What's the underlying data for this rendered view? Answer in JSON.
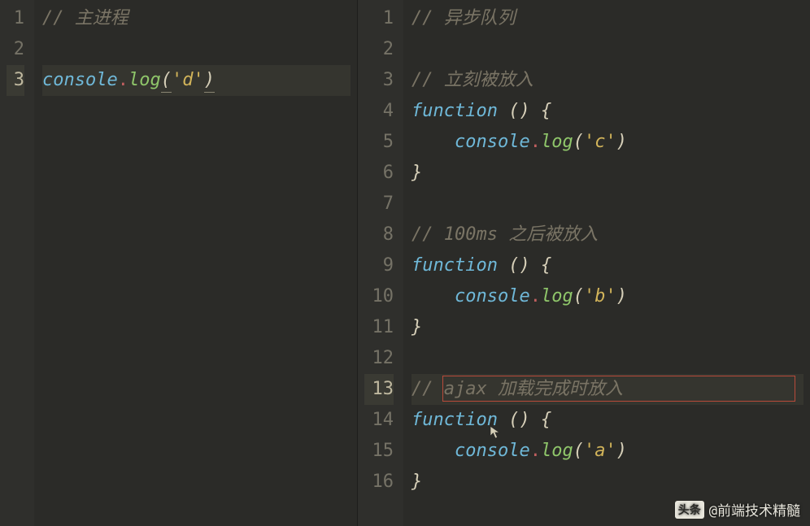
{
  "left": {
    "lines": [
      {
        "n": 1,
        "type": "comment",
        "text": "// 主进程"
      },
      {
        "n": 2,
        "type": "blank",
        "text": ""
      },
      {
        "n": 3,
        "type": "console",
        "obj": "console",
        "method": "log",
        "arg": "'d'",
        "highlight": true,
        "underline": true
      }
    ]
  },
  "right": {
    "lines": [
      {
        "n": 1,
        "type": "comment",
        "text": "// 异步队列"
      },
      {
        "n": 2,
        "type": "blank"
      },
      {
        "n": 3,
        "type": "comment",
        "text": "// 立刻被放入"
      },
      {
        "n": 4,
        "type": "fn-open",
        "kw": "function",
        "parens": "()",
        "brace": "{"
      },
      {
        "n": 5,
        "type": "console",
        "obj": "console",
        "method": "log",
        "arg": "'c'",
        "indent": true
      },
      {
        "n": 6,
        "type": "brace-close",
        "brace": "}"
      },
      {
        "n": 7,
        "type": "blank"
      },
      {
        "n": 8,
        "type": "comment",
        "text": "// 100ms 之后被放入"
      },
      {
        "n": 9,
        "type": "fn-open",
        "kw": "function",
        "parens": "()",
        "brace": "{"
      },
      {
        "n": 10,
        "type": "console",
        "obj": "console",
        "method": "log",
        "arg": "'b'",
        "indent": true
      },
      {
        "n": 11,
        "type": "brace-close",
        "brace": "}"
      },
      {
        "n": 12,
        "type": "blank"
      },
      {
        "n": 13,
        "type": "comment",
        "text": "// ajax 加载完成时放入",
        "highlight": true,
        "redbox": true
      },
      {
        "n": 14,
        "type": "fn-open",
        "kw": "function",
        "parens": "()",
        "brace": "{",
        "cursor": true
      },
      {
        "n": 15,
        "type": "console",
        "obj": "console",
        "method": "log",
        "arg": "'a'",
        "indent": true
      },
      {
        "n": 16,
        "type": "brace-close",
        "brace": "}"
      }
    ]
  },
  "watermark": {
    "badge": "头条",
    "text": "@前端技术精髓"
  }
}
